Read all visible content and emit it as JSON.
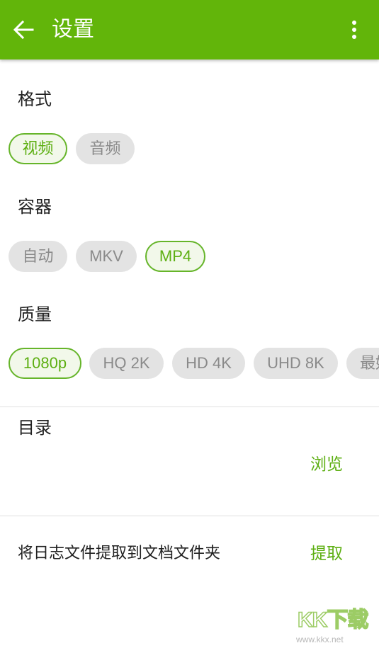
{
  "appbar": {
    "title": "设置",
    "back_icon": "arrow-left-icon",
    "menu_icon": "more-vertical-icon",
    "color": "#62b50a"
  },
  "format": {
    "title": "格式",
    "options": [
      {
        "label": "视频",
        "selected": true
      },
      {
        "label": "音频",
        "selected": false
      }
    ]
  },
  "container": {
    "title": "容器",
    "options": [
      {
        "label": "自动",
        "selected": false
      },
      {
        "label": "MKV",
        "selected": false
      },
      {
        "label": "MP4",
        "selected": true
      }
    ]
  },
  "quality": {
    "title": "质量",
    "options": [
      {
        "label": "1080p",
        "selected": true
      },
      {
        "label": "HQ 2K",
        "selected": false
      },
      {
        "label": "HD 4K",
        "selected": false
      },
      {
        "label": "UHD 8K",
        "selected": false
      },
      {
        "label": "最好",
        "selected": false
      }
    ]
  },
  "directory": {
    "title": "目录",
    "browse_label": "浏览"
  },
  "logs": {
    "label": "将日志文件提取到文档文件夹",
    "action_label": "提取"
  },
  "watermark": {
    "logo": "KK下载",
    "url": "www.kkx.net"
  },
  "colors": {
    "accent": "#5daf12",
    "chip_inactive_bg": "#e3e3e3",
    "chip_inactive_text": "#8a8a8a"
  }
}
